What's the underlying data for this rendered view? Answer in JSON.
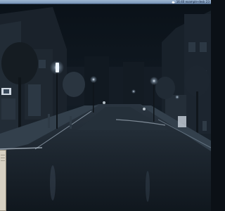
{
  "desktop": {
    "wallpaper_label": "",
    "tray": {
      "text": "16:40  example-desk  23",
      "icons": [
        "cloud-icon"
      ]
    },
    "colors": {
      "panel": "#8aa6c6",
      "panel_border": "#3e5473",
      "night_sky": "#0d141c",
      "street_light": "#eef6ff",
      "widget": "#d7d1c3"
    }
  }
}
